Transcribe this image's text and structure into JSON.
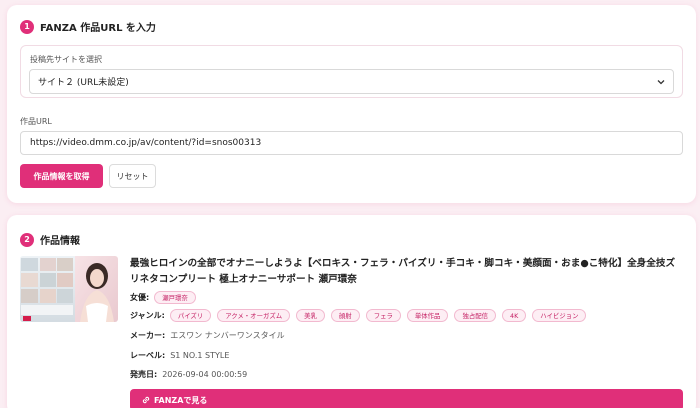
{
  "accent_color": "#e02f79",
  "section1": {
    "step": "1",
    "title": "FANZA 作品URL を入力",
    "site_select": {
      "label": "投稿先サイトを選択",
      "selected_value": "サイト２ (URL未設定)"
    },
    "url_field": {
      "label": "作品URL",
      "value": "https://video.dmm.co.jp/av/content/?id=snos00313"
    },
    "fetch_button": "作品情報を取得",
    "reset_button": "リセット"
  },
  "section2": {
    "step": "2",
    "title": "作品情報",
    "product_title": "最強ヒロインの全部でオナニーしようよ【ベロキス・フェラ・パイズリ・手コキ・脚コキ・美顔面・おま●こ特化】全身全技ズリネタコンプリート 極上オナニーサポート 瀬戸環奈",
    "actress_label": "女優:",
    "actresses": [
      "瀬戸環奈"
    ],
    "genre_label": "ジャンル:",
    "genres": [
      "パイズリ",
      "アクメ・オーガズム",
      "美乳",
      "顔射",
      "フェラ",
      "単体作品",
      "独占配信",
      "4K",
      "ハイビジョン"
    ],
    "maker_label": "メーカー:",
    "maker": "エスワン ナンバーワンスタイル",
    "label_label": "レーベル:",
    "label": "S1 NO.1 STYLE",
    "release_label": "発売日:",
    "release_date": "2026-09-04 00:00:59",
    "fanza_button": "FANZAで見る",
    "fanza_icon": "link-icon"
  }
}
